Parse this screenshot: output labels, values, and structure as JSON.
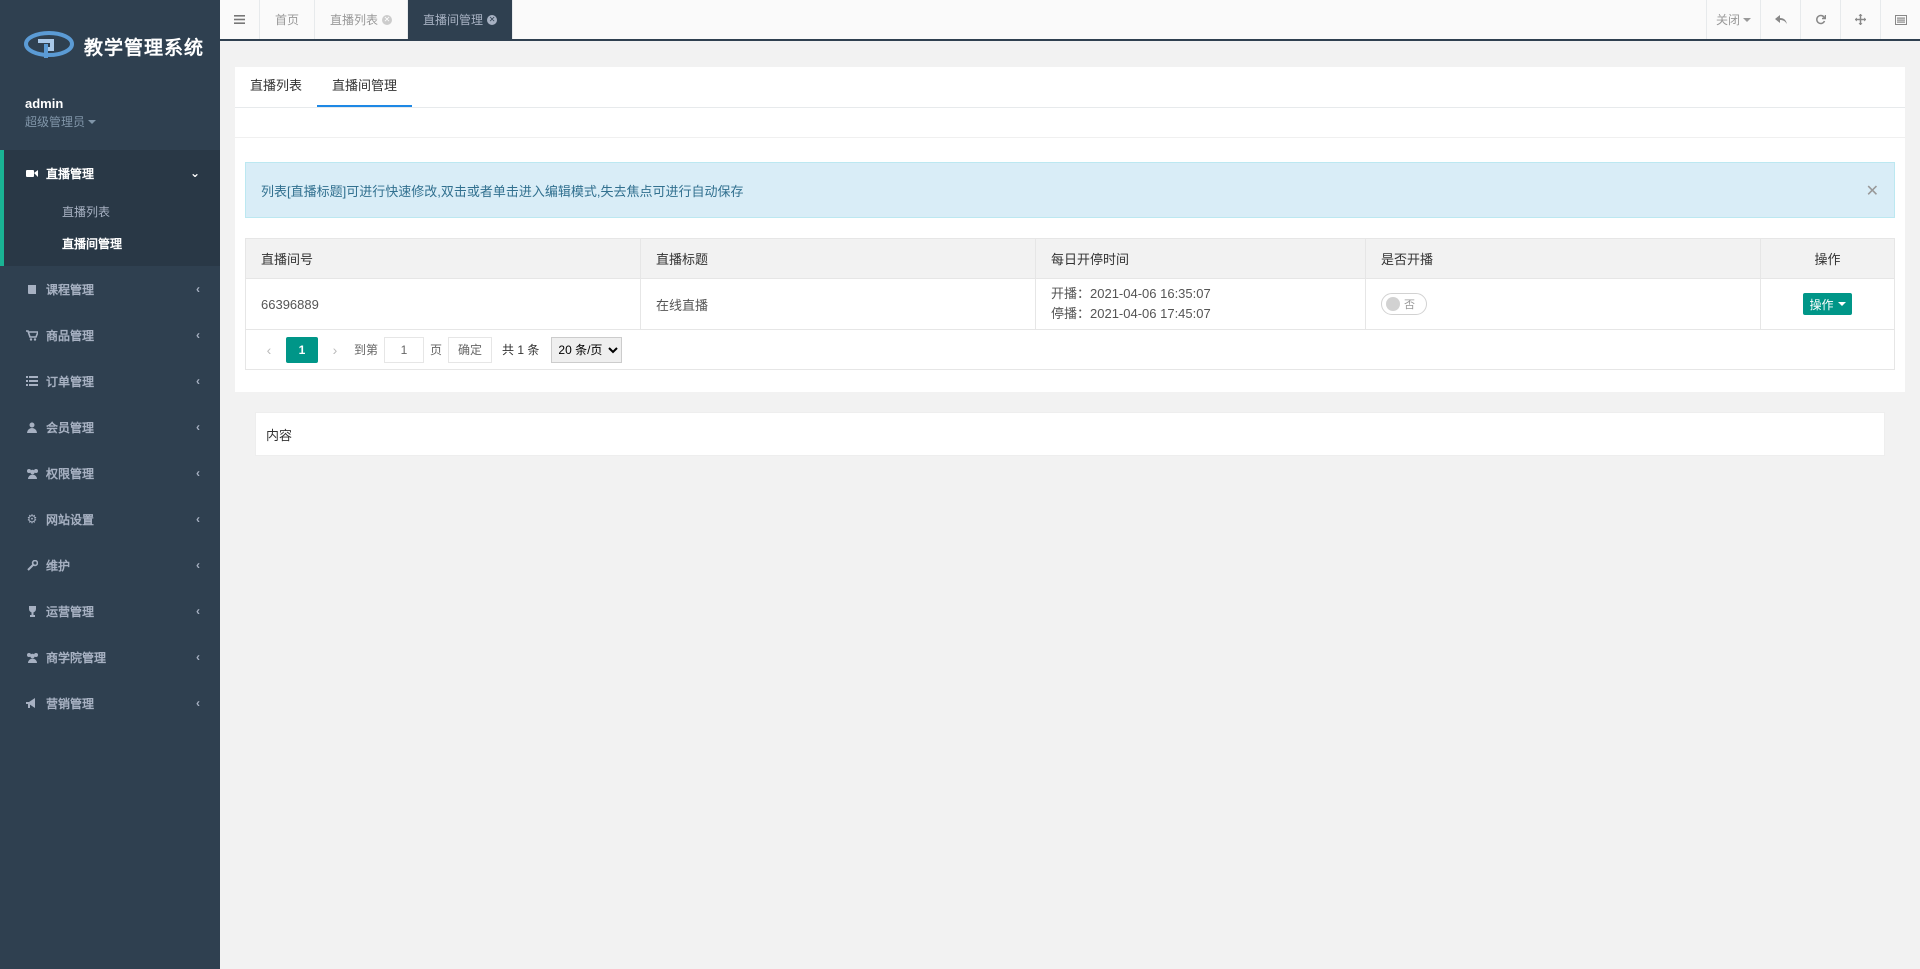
{
  "app": {
    "title": "教学管理系统",
    "user_name": "admin",
    "user_role": "超级管理员"
  },
  "sidebar": {
    "active_group": {
      "label": "直播管理",
      "icon": "video-icon",
      "children": [
        {
          "label": "直播列表",
          "current": false
        },
        {
          "label": "直播间管理",
          "current": true
        }
      ]
    },
    "items": [
      {
        "label": "课程管理",
        "icon": "book-icon"
      },
      {
        "label": "商品管理",
        "icon": "cart-icon"
      },
      {
        "label": "订单管理",
        "icon": "list-icon"
      },
      {
        "label": "会员管理",
        "icon": "user-icon"
      },
      {
        "label": "权限管理",
        "icon": "users-icon"
      },
      {
        "label": "网站设置",
        "icon": "gear-icon"
      },
      {
        "label": "维护",
        "icon": "wrench-icon"
      },
      {
        "label": "运营管理",
        "icon": "trophy-icon"
      },
      {
        "label": "商学院管理",
        "icon": "group-icon"
      },
      {
        "label": "营销管理",
        "icon": "bullhorn-icon"
      }
    ]
  },
  "topbar": {
    "tabs": [
      {
        "label": "首页",
        "closable": false,
        "active": false
      },
      {
        "label": "直播列表",
        "closable": true,
        "active": false
      },
      {
        "label": "直播间管理",
        "closable": true,
        "active": true
      }
    ],
    "close_label": "关闭"
  },
  "page": {
    "tabs": [
      {
        "label": "直播列表",
        "active": false
      },
      {
        "label": "直播间管理",
        "active": true
      }
    ],
    "alert_text": "列表[直播标题]可进行快速修改,双击或者单击进入编辑模式,失去焦点可进行自动保存",
    "table": {
      "headers": [
        "直播间号",
        "直播标题",
        "每日开停时间",
        "是否开播",
        "操作"
      ],
      "rows": [
        {
          "room_id": "66396889",
          "title": "在线直播",
          "start": "开播：2021-04-06 16:35:07",
          "stop": "停播：2021-04-06 17:45:07",
          "live_switch": "否",
          "action_label": "操作"
        }
      ]
    },
    "pager": {
      "current": "1",
      "goto_label": "到第",
      "goto_value": "1",
      "page_unit": "页",
      "confirm_label": "确定",
      "total_text": "共 1 条",
      "page_size": "20 条/页"
    },
    "content_card": "内容"
  },
  "colors": {
    "sidebar_bg": "#2f4050",
    "accent_green": "#009688",
    "active_border": "#1ab394",
    "tab_underline": "#1e88e5"
  }
}
